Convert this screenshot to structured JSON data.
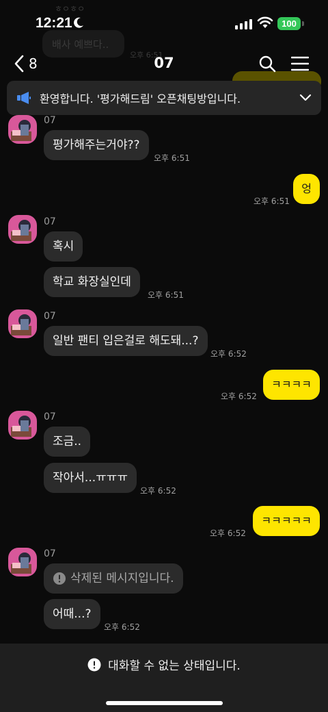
{
  "status": {
    "time": "12:21",
    "battery": "100"
  },
  "nav": {
    "back_count": "8",
    "title": "07"
  },
  "ghost": {
    "top_text": "ㅎㅇㅎㅇ",
    "bubble_text": "배사 예쁘다..",
    "time_text": "오후 6:51"
  },
  "notice": {
    "text": "환영합니다. '평가해드림' 오픈채팅방입니다."
  },
  "messages": [
    {
      "sender": "07",
      "bubbles": [
        "평가해주는거야??"
      ],
      "time": "오후 6:51"
    },
    {
      "out": "엉",
      "time": "오후 6:51"
    },
    {
      "sender": "07",
      "bubbles": [
        "혹시",
        "학교 화장실인데"
      ],
      "time": "오후 6:51"
    },
    {
      "sender": "07",
      "bubbles": [
        "일반 팬티 입은걸로 해도돼...?"
      ],
      "time": "오후 6:52"
    },
    {
      "out": "ㅋㅋㅋㅋ",
      "time": "오후 6:52"
    },
    {
      "sender": "07",
      "bubbles": [
        "조금..",
        "작아서...ㅠㅠㅠ"
      ],
      "time": "오후 6:52"
    },
    {
      "out": "ㅋㅋㅋㅋㅋ",
      "time": "오후 6:52"
    },
    {
      "sender": "07",
      "bubbles": [
        "삭제된 메시지입니다.",
        "어때...?"
      ],
      "time": "오후 6:52"
    }
  ],
  "footer": {
    "text": "대화할 수 없는 상태입니다."
  },
  "colors": {
    "bubble_out": "#fee500",
    "bubble_in": "#2b2b2b",
    "avatar": "#d8589a",
    "battery": "#34c759"
  },
  "icons": [
    "moon-icon",
    "signal-icon",
    "wifi-icon",
    "back-chevron-icon",
    "search-icon",
    "menu-icon",
    "megaphone-icon",
    "chevron-down-icon",
    "alert-icon"
  ]
}
